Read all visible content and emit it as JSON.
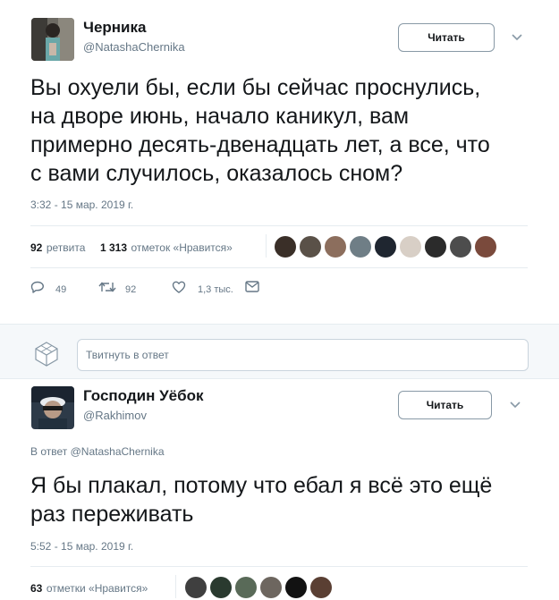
{
  "tweet1": {
    "name": "Черника",
    "handle": "@NatashaChernika",
    "follow_label": "Читать",
    "text_lines": [
      "Вы охуели бы, если бы сейчас проснулись,",
      "на дворе июнь, начало каникул, вам",
      "примерно десять-двенадцать лет, а все, что",
      "с вами случилось, оказалось сном?"
    ],
    "timestamp": "3:32 - 15 мар. 2019 г.",
    "retweets_count": "92",
    "retweets_label": "ретвита",
    "likes_count": "1 313",
    "likes_label": "отметок «Нравится»",
    "actions": {
      "replies": "49",
      "retweets": "92",
      "likes": "1,3 тыс."
    }
  },
  "reply_box": {
    "placeholder": "Твитнуть в ответ"
  },
  "tweet2": {
    "name": "Господин Уёбок",
    "handle": "@Rakhimov",
    "follow_label": "Читать",
    "in_reply_prefix": "В ответ",
    "in_reply_handle": "@NatashaChernika",
    "text_lines": [
      "Я бы плакал, потому что ебал я всё это ещё",
      "раз переживать"
    ],
    "timestamp": "5:52 - 15 мар. 2019 г.",
    "likes_count": "63",
    "likes_label": "отметки «Нравится»"
  },
  "colors": {
    "text": "#14171a",
    "secondary": "#657786",
    "border": "#e6ecf0",
    "band": "#f5f8fa"
  }
}
